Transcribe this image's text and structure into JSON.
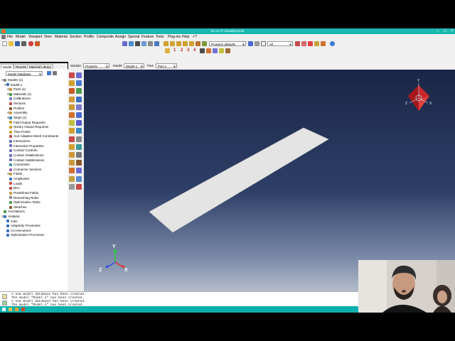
{
  "window": {
    "title": "Ex-vo-Ti-VisualExpedia"
  },
  "menu": [
    "File",
    "Model",
    "Viewport",
    "View",
    "Material",
    "Section",
    "Profile",
    "Composite",
    "Assign",
    "Special",
    "Feature",
    "Tools",
    "Plug-ins",
    "Help",
    "↗?"
  ],
  "toolbar": {
    "numbers": [
      "1",
      "2",
      "3",
      "4"
    ],
    "render_style": "Property defaults",
    "selection_filter": "All"
  },
  "context_bar": {
    "module_label": "Module:",
    "module_value": "Property",
    "model_label": "Model:",
    "model_value": "Model-1",
    "part_label": "Part:",
    "part_value": "Part-1"
  },
  "tree": {
    "tabs": [
      "Model",
      "Results",
      "Material Library"
    ],
    "dropdown_value": "Model Database",
    "items": [
      {
        "label": "Models (1)",
        "indent": 0,
        "exp": "⊟",
        "icon": "#888888"
      },
      {
        "label": "Model-1",
        "indent": 1,
        "exp": "⊟",
        "icon": "#3a6fc4"
      },
      {
        "label": "Parts (1)",
        "indent": 2,
        "exp": "⊞",
        "icon": "#c89a3a"
      },
      {
        "label": "Materials (1)",
        "indent": 2,
        "exp": "⊞",
        "icon": "#4aa04a"
      },
      {
        "label": "Calibrations",
        "indent": 2,
        "exp": "",
        "icon": "#7a7ad0"
      },
      {
        "label": "Sections",
        "indent": 2,
        "exp": "",
        "icon": "#c84a4a"
      },
      {
        "label": "Profiles",
        "indent": 2,
        "exp": "",
        "icon": "#8a5a2a"
      },
      {
        "label": "Assembly",
        "indent": 2,
        "exp": "⊞",
        "icon": "#c89a3a"
      },
      {
        "label": "Steps (1)",
        "indent": 2,
        "exp": "⊞",
        "icon": "#3a8ac4"
      },
      {
        "label": "Field Output Requests",
        "indent": 2,
        "exp": "",
        "icon": "#d0a020"
      },
      {
        "label": "History Output Requests",
        "indent": 2,
        "exp": "",
        "icon": "#d0a020"
      },
      {
        "label": "Time Points",
        "indent": 2,
        "exp": "",
        "icon": "#d0a020"
      },
      {
        "label": "ALE Adaptive Mesh Constraints",
        "indent": 2,
        "exp": "",
        "icon": "#c84a4a"
      },
      {
        "label": "Interactions",
        "indent": 2,
        "exp": "",
        "icon": "#6a6ac4"
      },
      {
        "label": "Interaction Properties",
        "indent": 2,
        "exp": "",
        "icon": "#6a6ac4"
      },
      {
        "label": "Contact Controls",
        "indent": 2,
        "exp": "",
        "icon": "#6a6ac4"
      },
      {
        "label": "Contact Initializations",
        "indent": 2,
        "exp": "",
        "icon": "#6a6ac4"
      },
      {
        "label": "Contact Stabilizations",
        "indent": 2,
        "exp": "",
        "icon": "#6a6ac4"
      },
      {
        "label": "Constraints",
        "indent": 2,
        "exp": "",
        "icon": "#3a9a9a"
      },
      {
        "label": "Connector Sections",
        "indent": 2,
        "exp": "",
        "icon": "#9a5ac4"
      },
      {
        "label": "Fields",
        "indent": 2,
        "exp": "⊞",
        "icon": "#c89a3a"
      },
      {
        "label": "Amplitudes",
        "indent": 2,
        "exp": "",
        "icon": "#3a7ac4"
      },
      {
        "label": "Loads",
        "indent": 2,
        "exp": "",
        "icon": "#c84a4a"
      },
      {
        "label": "BCs",
        "indent": 2,
        "exp": "",
        "icon": "#c84a4a"
      },
      {
        "label": "Predefined Fields",
        "indent": 2,
        "exp": "",
        "icon": "#c89a3a"
      },
      {
        "label": "Remeshing Rules",
        "indent": 2,
        "exp": "",
        "icon": "#8a8a8a"
      },
      {
        "label": "Optimization Tasks",
        "indent": 2,
        "exp": "",
        "icon": "#4aa04a"
      },
      {
        "label": "Sketches",
        "indent": 2,
        "exp": "",
        "icon": "#8a5a2a"
      },
      {
        "label": "Annotations",
        "indent": 0,
        "exp": "",
        "icon": "#4a9a4a"
      },
      {
        "label": "Analysis",
        "indent": 0,
        "exp": "⊟",
        "icon": "#3a6fc4"
      },
      {
        "label": "Jobs",
        "indent": 1,
        "exp": "",
        "icon": "#3a6fc4"
      },
      {
        "label": "Adaptivity Processes",
        "indent": 1,
        "exp": "",
        "icon": "#3a6fc4"
      },
      {
        "label": "Co-executions",
        "indent": 1,
        "exp": "",
        "icon": "#3a6fc4"
      },
      {
        "label": "Optimization Processes",
        "indent": 1,
        "exp": "",
        "icon": "#3a6fc4"
      }
    ]
  },
  "triad": {
    "x": "X",
    "y": "Y",
    "z": "Z"
  },
  "messages": [
    "A new model database has been created.",
    "The model \"Model-1\" has been created.",
    "A new model database has been created.",
    "The model \"Model-1\" has been created."
  ],
  "colors": {
    "title_bar": "#19b7b0",
    "viewport_top": "#1a2646",
    "viewport_bottom": "#b4bccc",
    "plate": "#e4e4e4"
  }
}
